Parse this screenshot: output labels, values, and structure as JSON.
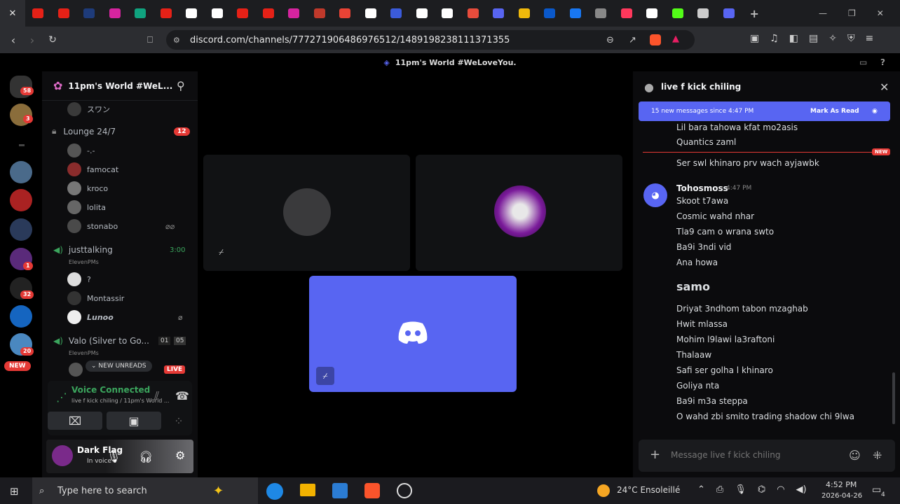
{
  "browser": {
    "tabs": [
      {
        "icon": "youtube-icon",
        "color": "#e62117"
      },
      {
        "icon": "youtube-icon",
        "color": "#e62117"
      },
      {
        "icon": "p-app-icon",
        "color": "#1e3b7a"
      },
      {
        "icon": "instagram-icon",
        "color": "#d6249f"
      },
      {
        "icon": "chatgpt-icon",
        "color": "#10a37f"
      },
      {
        "icon": "youtube-icon",
        "color": "#e62117"
      },
      {
        "icon": "tiktok-tv-icon",
        "color": "#ffffff"
      },
      {
        "icon": "play-forward-icon",
        "color": "#ffffff"
      },
      {
        "icon": "youtube-icon",
        "color": "#e62117"
      },
      {
        "icon": "youtube-icon",
        "color": "#e62117"
      },
      {
        "icon": "instagram-icon",
        "color": "#d6249f"
      },
      {
        "icon": "bird-icon",
        "color": "#c0392b"
      },
      {
        "icon": "gmail-icon",
        "color": "#ea4335"
      },
      {
        "icon": "p-circle-icon",
        "color": "#ffffff"
      },
      {
        "icon": "document-icon",
        "color": "#3b5bdb"
      },
      {
        "icon": "x-icon",
        "color": "#ffffff"
      },
      {
        "icon": "question-icon",
        "color": "#ffffff"
      },
      {
        "icon": "shield-target-icon",
        "color": "#e74c3c"
      },
      {
        "icon": "discord-alt-icon",
        "color": "#5865f2"
      },
      {
        "icon": "coin-icon",
        "color": "#f0b90b"
      },
      {
        "icon": "wave-icon",
        "color": "#0a58ca"
      },
      {
        "icon": "facebook-icon",
        "color": "#1877f2"
      },
      {
        "icon": "shield-icon",
        "color": "#888888"
      },
      {
        "icon": "airbnb-icon",
        "color": "#ff385c"
      },
      {
        "icon": "chatgpt-icon",
        "color": "#ffffff"
      },
      {
        "icon": "kick-icon",
        "color": "#53fc18"
      },
      {
        "icon": "speaker-icon",
        "color": "#cccccc"
      },
      {
        "icon": "discord-icon",
        "color": "#5865f2"
      }
    ],
    "url": "discord.com/channels/777271906486976512/1489198238111371355",
    "accent": "#5865f2"
  },
  "discord": {
    "window_title": "11pm's World #WeLoveYou.",
    "server_name": "11pm's World #WeL...",
    "rail_badges": {
      "home": "58",
      "s1": "3",
      "s5": "1",
      "s6": "32",
      "s7": "20",
      "new": "NEW"
    },
    "channel_top_user": "スワン",
    "lounge": {
      "name": "Lounge 24/7",
      "badge": "12",
      "members": [
        "-.-",
        "famocat",
        "kroco",
        "lolita",
        "stonabo"
      ]
    },
    "justtalking": {
      "name": "justtalking",
      "time": "3:00",
      "sub": "ElevenPMs",
      "members": [
        "?",
        "Montassir",
        "Lunoo"
      ]
    },
    "valo": {
      "name": "Valo (Silver to Go...",
      "count_a": "01",
      "count_b": "05",
      "sub": "ElevenPMs"
    },
    "new_unreads": "NEW UNREADS",
    "live": "LIVE",
    "voice": {
      "status": "Voice Connected",
      "channel": "live f kick chiling / 11pm's World ..."
    },
    "user": {
      "name": "Dark Flag",
      "status": "In voice"
    },
    "chat": {
      "channel": "live f kick chiling",
      "banner": "15 new messages since 4:47 PM",
      "mark_read": "Mark As Read",
      "new_tag": "NEW",
      "pre_lines": [
        "Lil bara tahowa kfat mo2asis",
        "Quantics zaml"
      ],
      "after_new": "Ser swl khinaro prv wach ayjawbk",
      "author": "Tohosmoss",
      "time": "4:47 PM",
      "lines1": [
        "Skoot t7awa",
        "Cosmic wahd nhar",
        "Tla9 cam o wrana swto",
        "Ba9i 3ndi vid",
        "Ana howa"
      ],
      "big": "samo",
      "lines2": [
        "Driyat 3ndhom tabon mzaghab",
        "Hwit mlassa",
        "Mohim l9lawi la3raftoni",
        "Thalaaw",
        "Safi ser golha l khinaro",
        "Goliya nta",
        "Ba9i m3a steppa",
        "O wahd zbi smito trading shadow chi 9lwa"
      ],
      "placeholder": "Message live f kick chiling"
    }
  },
  "taskbar": {
    "search": "Type here to search",
    "weather": "24°C  Ensoleillé",
    "time": "4:52 PM",
    "date": "2026-04-26",
    "notif": "4"
  }
}
